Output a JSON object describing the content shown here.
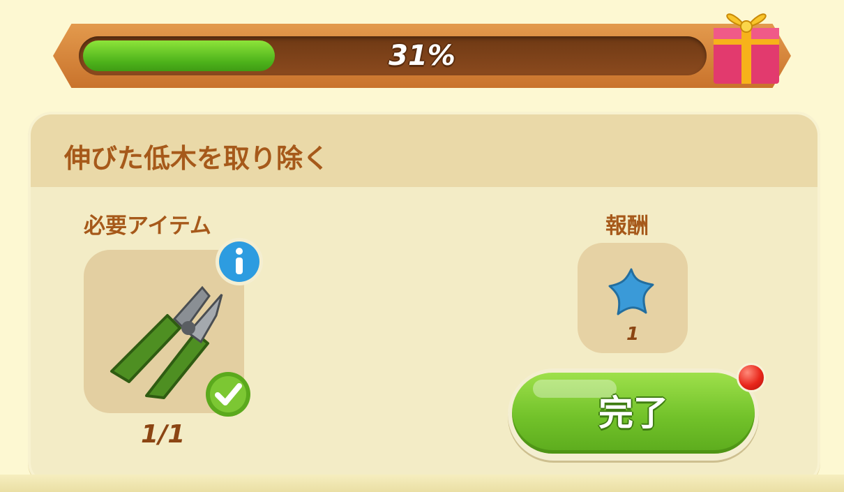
{
  "progress": {
    "percent": 31,
    "label": "31%",
    "reward_icon": "gift-box-icon"
  },
  "task": {
    "title": "伸びた低木を取り除く",
    "required_label": "必要アイテム",
    "required_item": {
      "icon": "pruning-shears-icon",
      "count": "1/1",
      "complete": true
    },
    "reward_label": "報酬",
    "reward": {
      "icon": "blue-star-icon",
      "count": "1"
    },
    "done_button": "完了",
    "has_notification": true
  },
  "colors": {
    "accent_green": "#72c22a",
    "label_brown": "#a6591a",
    "bar_orange": "#d8853a",
    "notify_red": "#e8261a"
  }
}
